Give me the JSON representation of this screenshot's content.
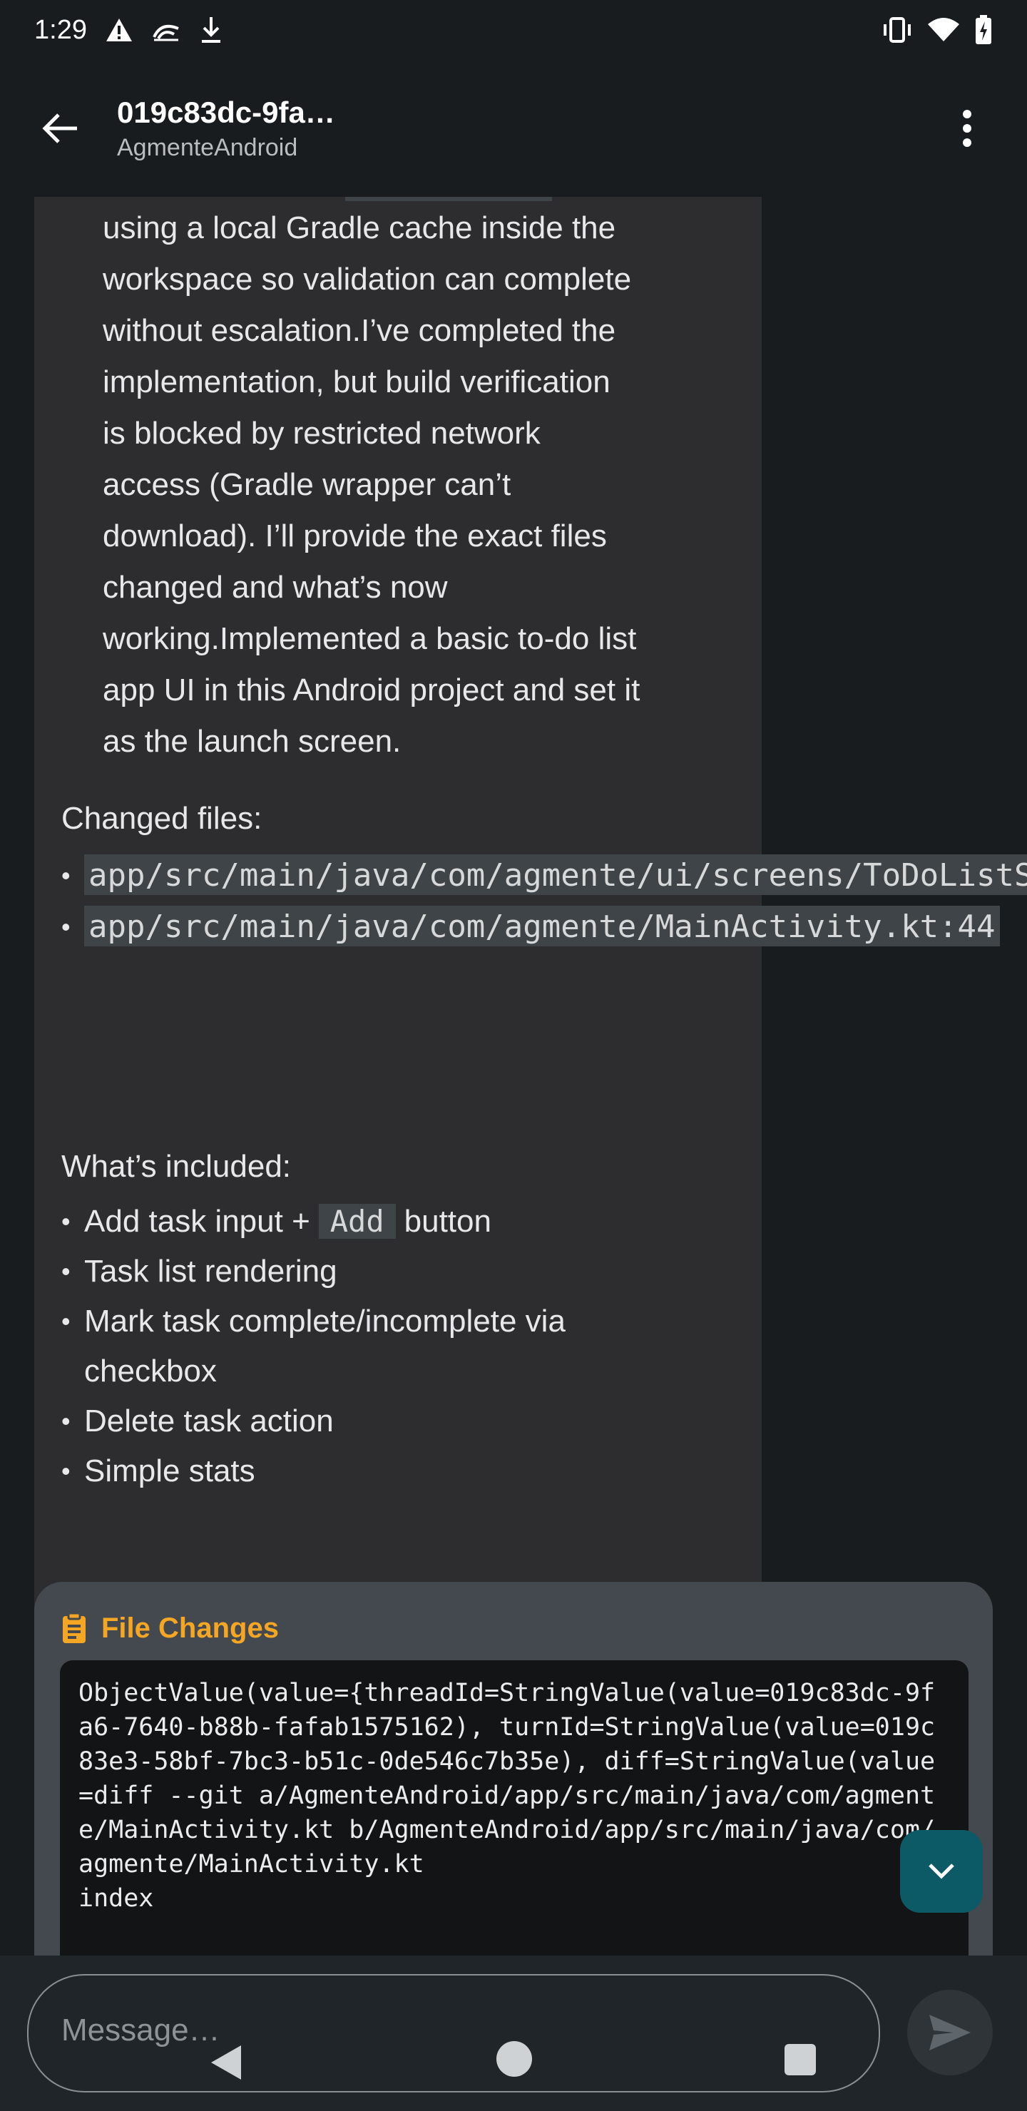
{
  "status_bar": {
    "time": "1:29"
  },
  "app_bar": {
    "title": "019c83dc-9fa…",
    "subtitle": "AgmenteAndroid"
  },
  "message": {
    "paragraph_lines": [
      "using a local Gradle cache inside the",
      "workspace so validation can complete",
      "without escalation.I’ve completed the",
      "implementation, but build verification",
      "is blocked by restricted network",
      "access (Gradle wrapper can’t",
      "download). I’ll provide the exact files",
      "changed and what’s now",
      "working.Implemented a basic to-do list",
      "app UI in this Android project and set it",
      "as the launch screen."
    ],
    "changed_files_heading": "Changed files:",
    "changed_files": [
      "app/src/main/java/com/agmente/ui/screens/ToDoListScreen.kt",
      "app/src/main/java/com/agmente/MainActivity.kt:44"
    ],
    "whats_included_heading": "What’s included:",
    "included": {
      "item1_before": "Add task input +",
      "item1_code": "Add",
      "item1_after": "button",
      "item2": "Task list rendering",
      "item3": "Mark task complete/incomplete via checkbox",
      "item4": "Delete task action",
      "item5": "Simple stats"
    }
  },
  "file_changes": {
    "title": "File Changes",
    "code": "ObjectValue(value={threadId=StringValue(value=019c83dc-9fa6-7640-b88b-fafab1575162), turnId=StringValue(value=019c83e3-58bf-7bc3-b51c-0de546c7b35e), diff=StringValue(value=diff --git a/AgmenteAndroid/app/src/main/java/com/agmente/MainActivity.kt b/AgmenteAndroid/app/src/main/java/com/agmente/MainActivity.kt\nindex"
  },
  "composer": {
    "placeholder": "Message…"
  },
  "colors": {
    "accent_orange": "#f5a623",
    "fab_teal": "#0c5a66",
    "bubble_bg": "#2d2d30",
    "code_chip_bg": "#3e4447"
  },
  "icons": {
    "status": [
      "warning-icon",
      "hotspot-icon",
      "download-icon",
      "vibrate-icon",
      "wifi-icon",
      "battery-charging-icon"
    ],
    "app_bar": [
      "back-arrow-icon",
      "more-vert-icon"
    ],
    "file_changes": "document-icon",
    "fab": "chevron-down-icon",
    "send": "send-icon"
  }
}
